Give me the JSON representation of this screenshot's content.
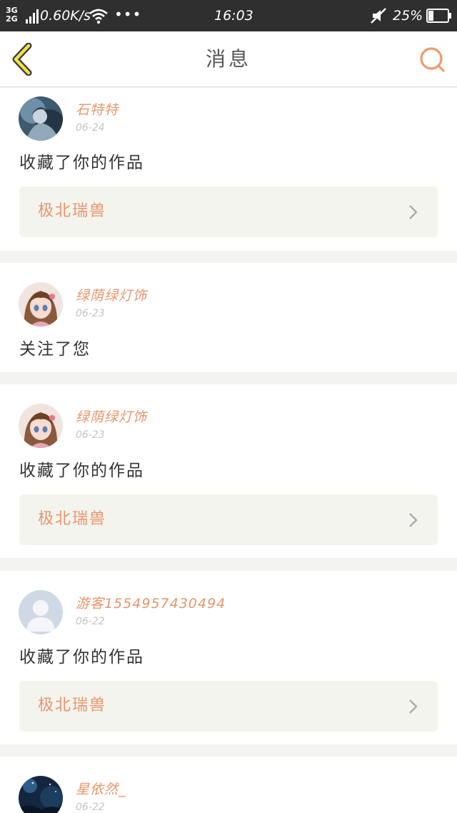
{
  "status_bar": {
    "network_top": "3G",
    "network_bottom": "2G",
    "speed": "0.60K/s",
    "more": "•••",
    "time": "16:03",
    "battery_percent": "25%",
    "battery_level": 0.25
  },
  "nav": {
    "title": "消息",
    "back_icon": "back-chevron-icon",
    "search_icon": "search-icon"
  },
  "accent_color": "#e8956a",
  "messages": [
    {
      "name": "石特特",
      "date": "06-24",
      "action": "收藏了你的作品",
      "work": "极北瑞兽",
      "avatar": "dark-anime-avatar"
    },
    {
      "name": "绿荫绿灯饰",
      "date": "06-23",
      "action": "关注了您",
      "avatar": "anime-girl-avatar"
    },
    {
      "name": "绿荫绿灯饰",
      "date": "06-23",
      "action": "收藏了你的作品",
      "work": "极北瑞兽",
      "avatar": "anime-girl-avatar"
    },
    {
      "name": "游客1554957430494",
      "date": "06-22",
      "action": "收藏了你的作品",
      "work": "极北瑞兽",
      "avatar": "default-user-avatar"
    },
    {
      "name": "星依然_",
      "date": "06-22",
      "avatar": "dark-night-avatar"
    }
  ]
}
